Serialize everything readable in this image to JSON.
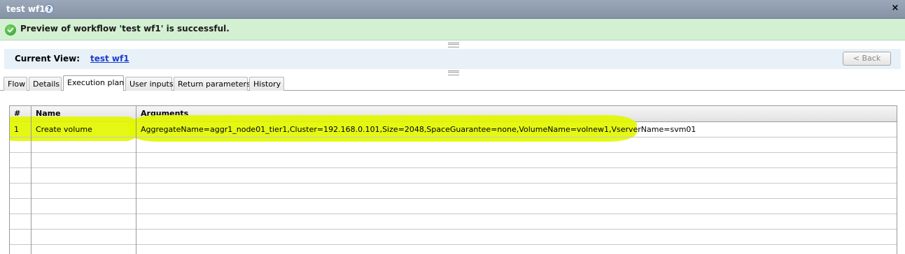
{
  "window": {
    "title": "test wf1",
    "help_icon": "?",
    "close_icon": "×"
  },
  "banner": {
    "message": "Preview of workflow 'test wf1' is successful.",
    "status_icon": "check-circle-icon",
    "color": "#d4f0d2"
  },
  "view": {
    "label": "Current View:",
    "link": "test wf1",
    "back_label": "< Back"
  },
  "tabs": [
    {
      "label": "Flow",
      "active": false
    },
    {
      "label": "Details",
      "active": false
    },
    {
      "label": "Execution plan",
      "active": true
    },
    {
      "label": "User inputs",
      "active": false
    },
    {
      "label": "Return parameters",
      "active": false
    },
    {
      "label": "History",
      "active": false
    }
  ],
  "table": {
    "columns": [
      "#",
      "Name",
      "Arguments"
    ],
    "rows": [
      {
        "num": "1",
        "name": "Create volume",
        "arguments": "AggregateName=aggr1_node01_tier1,Cluster=192.168.0.101,Size=2048,SpaceGuarantee=none,VolumeName=volnew1,VserverName=svm01"
      }
    ]
  },
  "colors": {
    "highlight": "#e3f700",
    "selected_row": "#d9f2cf",
    "link": "#1a3ccc"
  }
}
